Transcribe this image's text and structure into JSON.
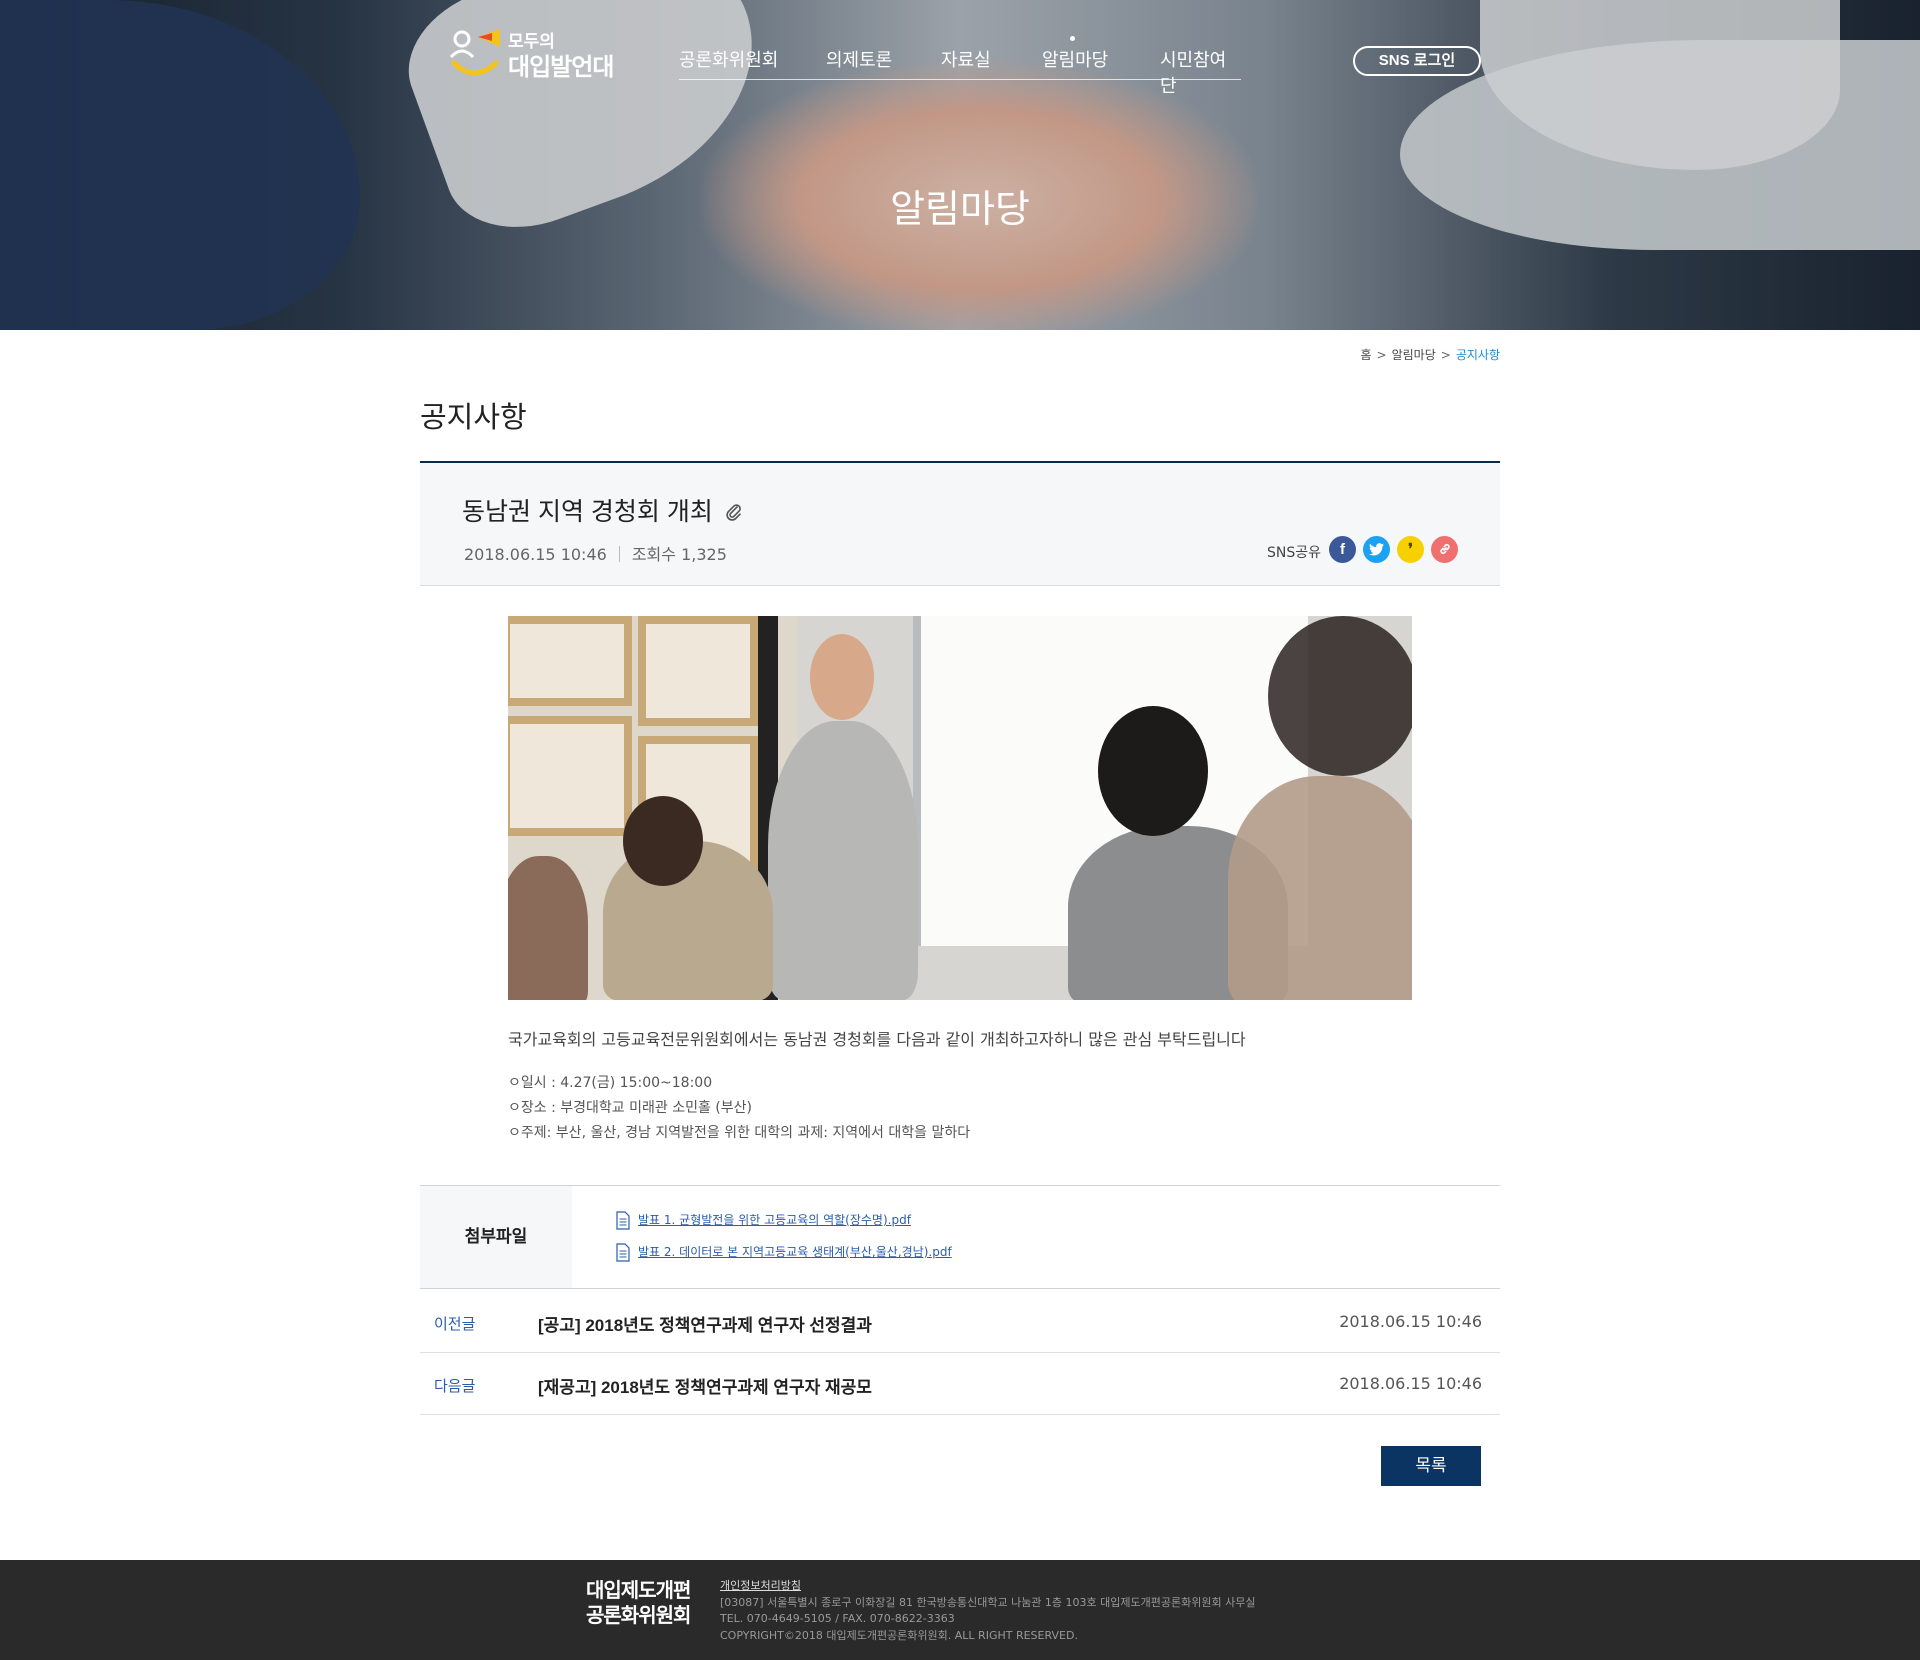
{
  "header": {
    "logo": {
      "line1": "모두의",
      "line2": "대입발언대"
    },
    "nav": [
      "공론화위원회",
      "의제토론",
      "자료실",
      "알림마당",
      "시민참여단"
    ],
    "active_nav_index": 3,
    "sns_login_label": "SNS 로그인",
    "hero_title": "알림마당"
  },
  "breadcrumb": {
    "home": "홈",
    "section": "알림마당",
    "current": "공지사항"
  },
  "page_title": "공지사항",
  "post": {
    "title": "동남권 지역 경청회 개최",
    "date": "2018.06.15  10:46",
    "views_label": "조회수",
    "views": "1,325",
    "sns_label": "SNS공유",
    "body": "국가교육회의 고등교육전문위원회에서는 동남권 경청회를 다음과 같이 개최하고자하니 많은 관심 부탁드립니다",
    "details": [
      "ㅇ일시 : 4.27(금) 15:00~18:00",
      "ㅇ장소 : 부경대학교 미래관 소민홀 (부산)",
      "ㅇ주제: 부산, 울산, 경남 지역발전을 위한 대학의 과제: 지역에서 대학을 말하다"
    ]
  },
  "attachments": {
    "label": "첨부파일",
    "files": [
      "발표 1. 균형발전을 위한 고등교육의 역할(장수명).pdf",
      "발표 2. 데이터로 본 지역고등교육 생태계(부산,울산,경남).pdf"
    ]
  },
  "prev": {
    "label": "이전글",
    "title": "[공고] 2018년도 정책연구과제 연구자 선정결과",
    "date": "2018.06.15  10:46"
  },
  "next": {
    "label": "다음글",
    "title": "[재공고] 2018년도 정책연구과제 연구자 재공모",
    "date": "2018.06.15  10:46"
  },
  "list_button": "목록",
  "footer": {
    "org_line1": "대입제도개편",
    "org_line2": "공론화위원회",
    "policy": "개인정보처리방침",
    "address": "[03087] 서울특별시 종로구 이화장길 81 한국방송통신대학교 나눔관 1층 103호 대입제도개편공론화위원회 사무실",
    "contact": "TEL. 070-4649-5105 / FAX. 070-8622-3363",
    "copyright": "COPYRIGHT©2018 대입제도개편공론화위원회. ALL RIGHT RESERVED."
  },
  "icons": {
    "facebook": "facebook-icon",
    "twitter": "twitter-icon",
    "kakaostory": "kakaostory-icon",
    "link": "link-icon",
    "attachment": "paperclip-icon",
    "file": "document-icon"
  },
  "colors": {
    "primary": "#0c3462",
    "link": "#2a5dab",
    "breadcrumb_current": "#1a8fd6",
    "footer_bg": "#2a2a2a"
  }
}
